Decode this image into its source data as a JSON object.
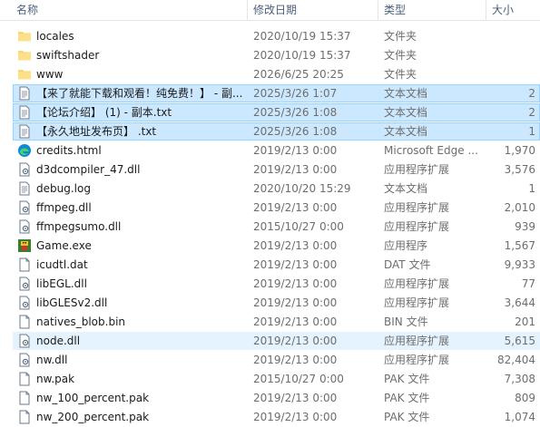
{
  "header": {
    "name": "名称",
    "date": "修改日期",
    "type": "类型",
    "size": "大小"
  },
  "rows": [
    {
      "name": "locales",
      "date": "2020/10/19 15:37",
      "type": "文件夹",
      "size": "",
      "icon": "folder-icon",
      "state": ""
    },
    {
      "name": "swiftshader",
      "date": "2020/10/19 15:37",
      "type": "文件夹",
      "size": "",
      "icon": "folder-icon",
      "state": ""
    },
    {
      "name": "www",
      "date": "2026/6/25 20:25",
      "type": "文件夹",
      "size": "",
      "icon": "folder-icon",
      "state": ""
    },
    {
      "name": "【来了就能下载和观看！纯免费！】 - 副...",
      "date": "2025/3/26 1:07",
      "type": "文本文档",
      "size": "2",
      "icon": "text-file-icon",
      "state": "sel"
    },
    {
      "name": "【论坛介绍】 (1) - 副本.txt",
      "date": "2025/3/26 1:08",
      "type": "文本文档",
      "size": "2",
      "icon": "text-file-icon",
      "state": "sel"
    },
    {
      "name": "【永久地址发布页】 .txt",
      "date": "2025/3/26 1:08",
      "type": "文本文档",
      "size": "1",
      "icon": "text-file-icon",
      "state": "sel"
    },
    {
      "name": "credits.html",
      "date": "2019/2/13 0:00",
      "type": "Microsoft Edge ...",
      "size": "1,970",
      "icon": "edge-icon",
      "state": ""
    },
    {
      "name": "d3dcompiler_47.dll",
      "date": "2019/2/13 0:00",
      "type": "应用程序扩展",
      "size": "3,576",
      "icon": "dll-icon",
      "state": ""
    },
    {
      "name": "debug.log",
      "date": "2020/10/20 15:29",
      "type": "文本文档",
      "size": "1",
      "icon": "text-file-icon",
      "state": ""
    },
    {
      "name": "ffmpeg.dll",
      "date": "2019/2/13 0:00",
      "type": "应用程序扩展",
      "size": "2,010",
      "icon": "dll-icon",
      "state": ""
    },
    {
      "name": "ffmpegsumo.dll",
      "date": "2015/10/27 0:00",
      "type": "应用程序扩展",
      "size": "939",
      "icon": "dll-icon",
      "state": ""
    },
    {
      "name": "Game.exe",
      "date": "2019/2/13 0:00",
      "type": "应用程序",
      "size": "1,567",
      "icon": "game-exe-icon",
      "state": ""
    },
    {
      "name": "icudtl.dat",
      "date": "2019/2/13 0:00",
      "type": "DAT 文件",
      "size": "9,933",
      "icon": "blank-file-icon",
      "state": ""
    },
    {
      "name": "libEGL.dll",
      "date": "2019/2/13 0:00",
      "type": "应用程序扩展",
      "size": "77",
      "icon": "dll-icon",
      "state": ""
    },
    {
      "name": "libGLESv2.dll",
      "date": "2019/2/13 0:00",
      "type": "应用程序扩展",
      "size": "3,644",
      "icon": "dll-icon",
      "state": ""
    },
    {
      "name": "natives_blob.bin",
      "date": "2019/2/13 0:00",
      "type": "BIN 文件",
      "size": "201",
      "icon": "blank-file-icon",
      "state": ""
    },
    {
      "name": "node.dll",
      "date": "2019/2/13 0:00",
      "type": "应用程序扩展",
      "size": "5,615",
      "icon": "dll-icon",
      "state": "hover"
    },
    {
      "name": "nw.dll",
      "date": "2019/2/13 0:00",
      "type": "应用程序扩展",
      "size": "82,404",
      "icon": "dll-icon",
      "state": ""
    },
    {
      "name": "nw.pak",
      "date": "2015/10/27 0:00",
      "type": "PAK 文件",
      "size": "7,308",
      "icon": "blank-file-icon",
      "state": ""
    },
    {
      "name": "nw_100_percent.pak",
      "date": "2019/2/13 0:00",
      "type": "PAK 文件",
      "size": "809",
      "icon": "blank-file-icon",
      "state": ""
    },
    {
      "name": "nw_200_percent.pak",
      "date": "2019/2/13 0:00",
      "type": "PAK 文件",
      "size": "1,074",
      "icon": "blank-file-icon",
      "state": ""
    }
  ]
}
